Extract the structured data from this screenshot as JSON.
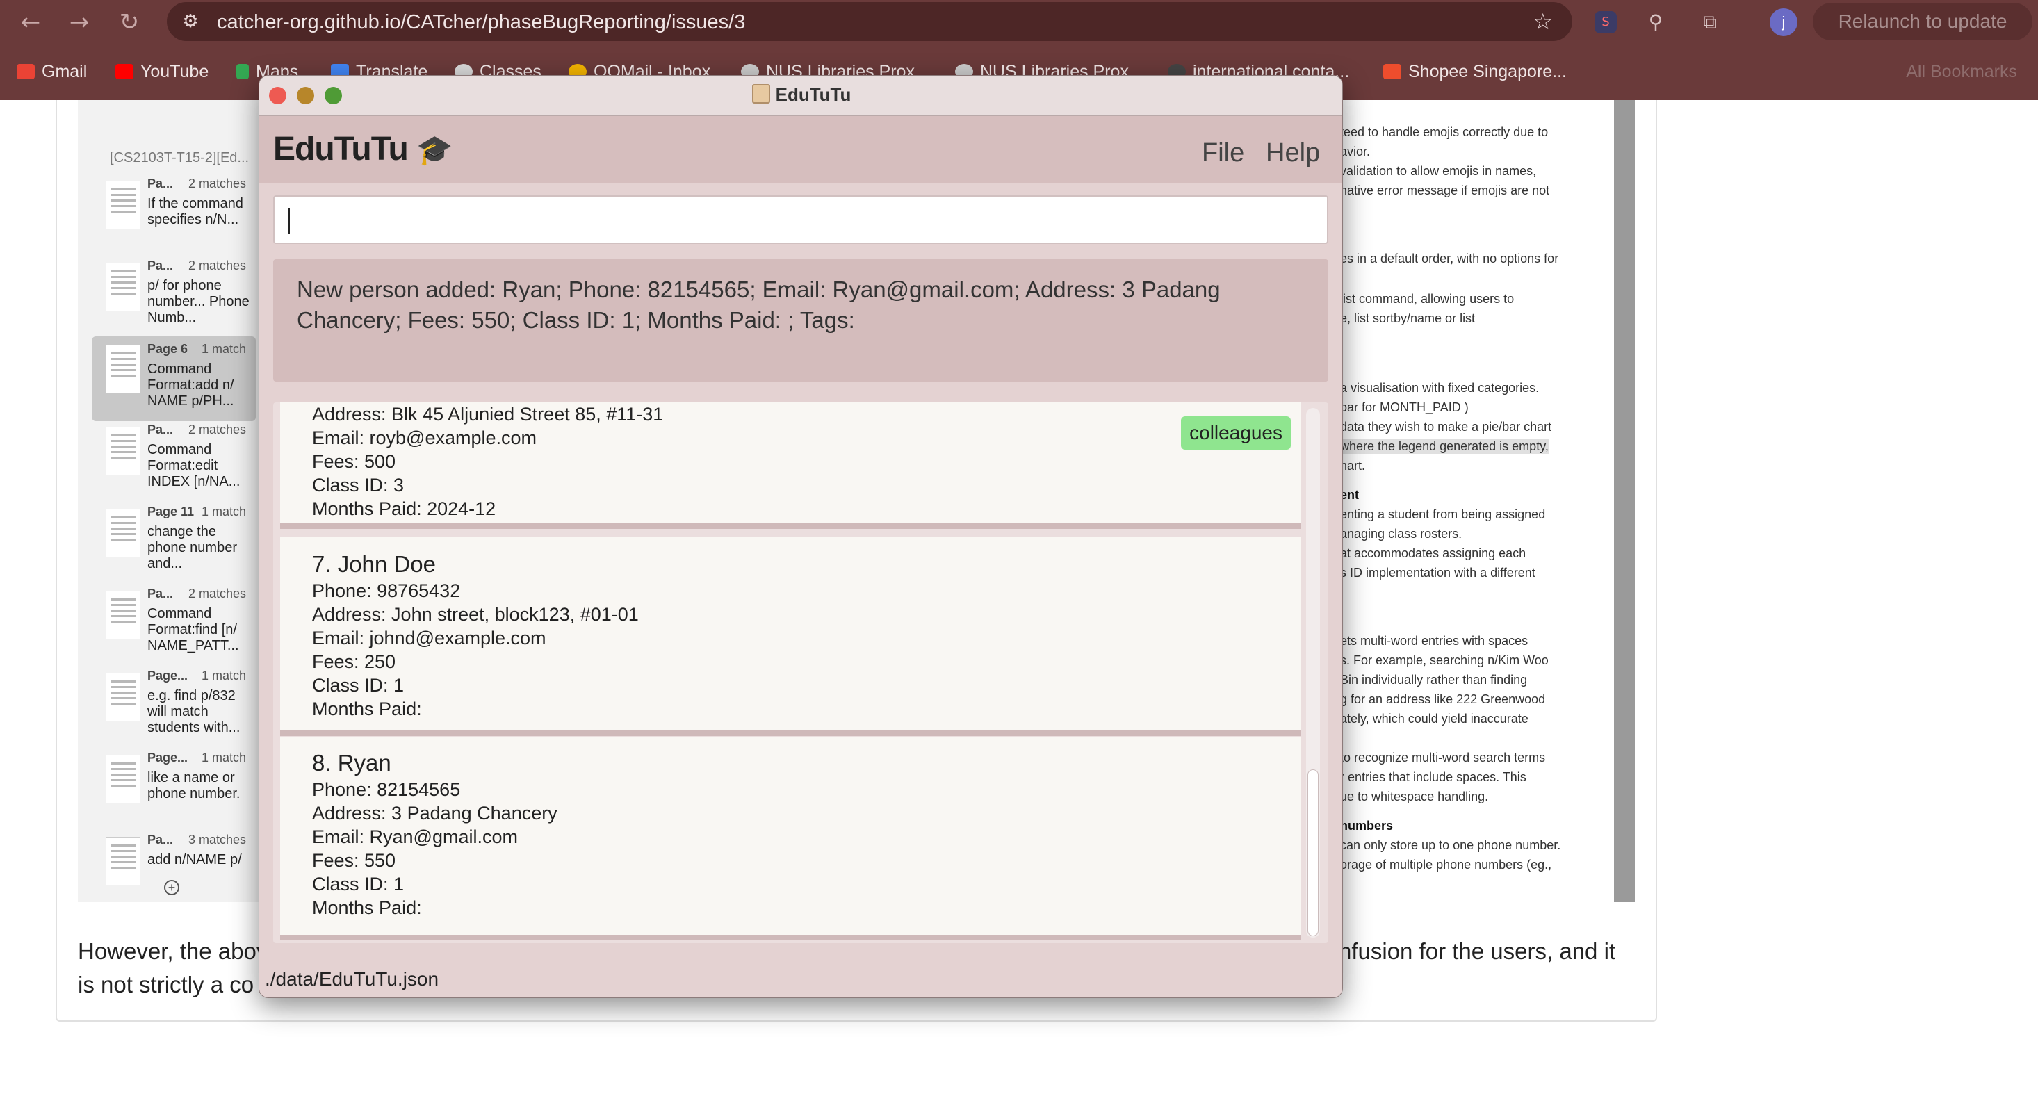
{
  "browser": {
    "url": "catcher-org.github.io/CATcher/phaseBugReporting/issues/3",
    "relaunch_label": "Relaunch to update",
    "profile_initial": "j",
    "bookmarks": [
      "Gmail",
      "YouTube",
      "Maps",
      "Translate",
      "Classes",
      "OOMail - Inbox",
      "NUS Libraries Prox...",
      "NUS Libraries Prox...",
      "international conta...",
      "Shopee Singapore..."
    ],
    "all_bookmarks": "All Bookmarks"
  },
  "pdf": {
    "doc_title": "[CS2103T-T15-2][Ed...",
    "results": [
      {
        "page": "Pa...",
        "matches": "2 matches",
        "text": "If the command specifies n/N..."
      },
      {
        "page": "Pa...",
        "matches": "2 matches",
        "text": "p/ for phone number... Phone Numb..."
      },
      {
        "page": "Page 6",
        "matches": "1 match",
        "text": "Command Format:add n/ NAME p/PH..."
      },
      {
        "page": "Pa...",
        "matches": "2 matches",
        "text": "Command Format:edit INDEX [n/NA..."
      },
      {
        "page": "Page 11",
        "matches": "1 match",
        "text": "change the phone number and..."
      },
      {
        "page": "Pa...",
        "matches": "2 matches",
        "text": "Command Format:find [n/ NAME_PATT..."
      },
      {
        "page": "Page...",
        "matches": "1 match",
        "text": "e.g. find p/832 will match students with..."
      },
      {
        "page": "Page...",
        "matches": "1 match",
        "text": "like a name or phone number."
      },
      {
        "page": "Pa...",
        "matches": "3 matches",
        "text": "add n/NAME p/"
      }
    ],
    "fragments": [
      "teed to handle emojis correctly due to",
      "avior.",
      "validation to allow emojis in names,",
      "native error message if emojis are not",
      "es in a default order, with no options for",
      "list command, allowing users to",
      "e, list sortby/name or list",
      "a visualisation with fixed categories.",
      "bar for MONTH_PAID )",
      "data they wish to make a pie/bar chart",
      "where the legend generated is empty,",
      "hart.",
      "ent",
      "enting a student from being assigned",
      "anaging class rosters.",
      "at accommodates assigning each",
      "s ID implementation with a different",
      "ets multi-word entries with spaces",
      "s. For example, searching n/Kim Woo",
      "Bin individually rather than finding",
      "g for an address like 222 Greenwood",
      "ately, which could yield inaccurate",
      "to recognize multi-word search terms",
      "r entries that include spaces. This",
      "ue to whitespace handling.",
      "numbers",
      "can only store up to one phone number.",
      "orage of multiple phone numbers (eg.,"
    ],
    "page_text_1_left": "However, the abov",
    "page_text_1_right": "nfusion for the users, and it",
    "page_text_2_left": "is not strictly a co"
  },
  "app": {
    "window_title": "EduTuTu",
    "brand": "EduTuTu",
    "menu": {
      "file": "File",
      "help": "Help"
    },
    "command_value": "",
    "result_message": "New person added: Ryan; Phone: 82154565; Email: Ryan@gmail.com; Address: 3 Padang Chancery; Fees: 550; Class ID: 1; Months Paid: ; Tags:",
    "persons": [
      {
        "address": "Address:  Blk 45 Aljunied Street 85, #11-31",
        "email": "Email:  royb@example.com",
        "fees": "Fees:  500",
        "class_id": "Class ID:  3",
        "months_paid": "Months Paid:  2024-12",
        "tag": "colleagues"
      },
      {
        "name": "7. John Doe",
        "phone": "Phone:  98765432",
        "address": "Address:  John street, block123, #01-01",
        "email": "Email:  johnd@example.com",
        "fees": "Fees:  250",
        "class_id": "Class ID:  1",
        "months_paid": "Months Paid:"
      },
      {
        "name": "8. Ryan",
        "phone": "Phone:  82154565",
        "address": "Address:  3 Padang Chancery",
        "email": "Email:  Ryan@gmail.com",
        "fees": "Fees:  550",
        "class_id": "Class ID:  1",
        "months_paid": "Months Paid:"
      }
    ],
    "status_path": "./data/EduTuTu.json"
  }
}
